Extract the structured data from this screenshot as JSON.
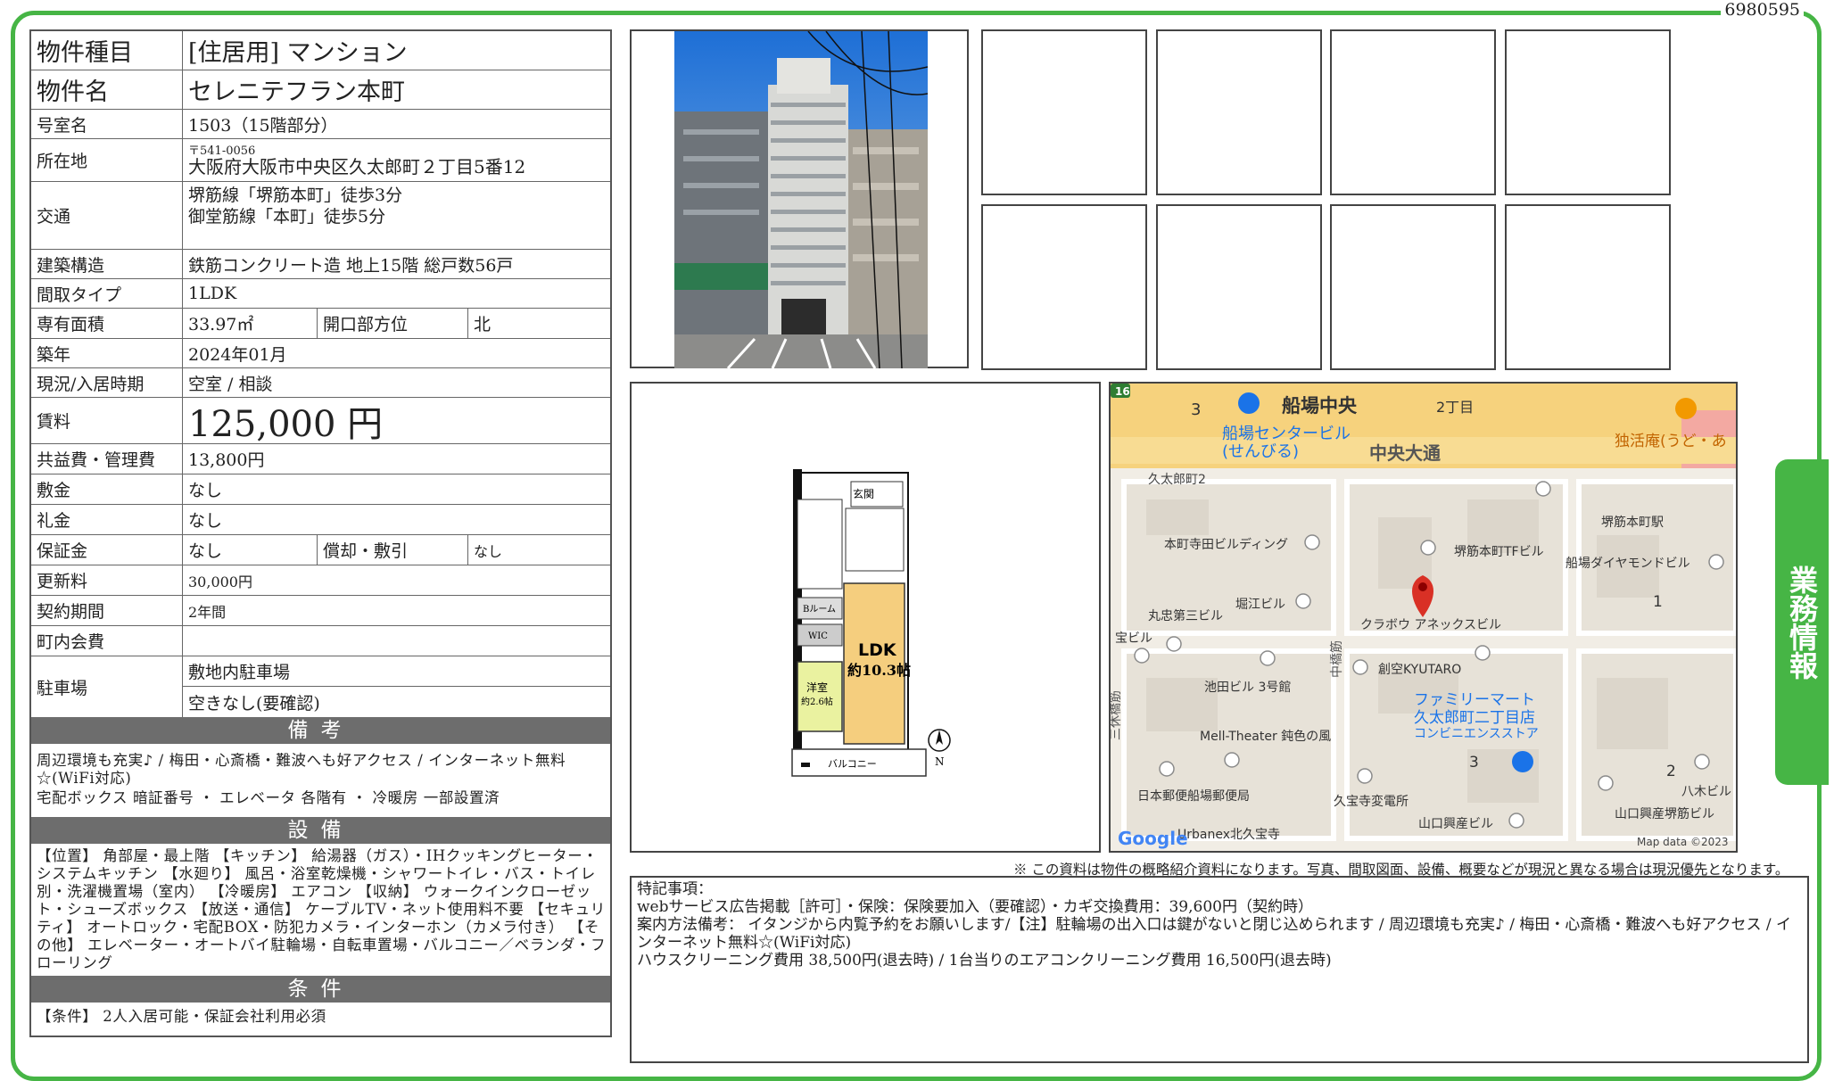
{
  "doc_id": "6980595",
  "side_tab": "業務情報",
  "property": {
    "type_label": "物件種目",
    "type_value": "[住居用] マンション",
    "name_label": "物件名",
    "name_value": "セレニテフラン本町",
    "room_label": "号室名",
    "room_value": "1503（15階部分）",
    "address_label": "所在地",
    "postal": "〒541-0056",
    "address_value": "大阪府大阪市中央区久太郎町２丁目5番12",
    "transport_label": "交通",
    "transport_1": "堺筋線「堺筋本町」徒歩3分",
    "transport_2": "御堂筋線「本町」徒歩5分",
    "structure_label": "建築構造",
    "structure_value": "鉄筋コンクリート造 地上15階 総戸数56戸",
    "layout_label": "間取タイプ",
    "layout_value": "1LDK",
    "area_label": "専有面積",
    "area_value": "33.97㎡",
    "direction_label": "開口部方位",
    "direction_value": "北",
    "built_label": "築年",
    "built_value": "2024年01月",
    "status_label": "現況/入居時期",
    "status_value": "空室 / 相談",
    "rent_label": "賃料",
    "rent_value": "125,000 円",
    "fee_label": "共益費・管理費",
    "fee_value": "13,800円",
    "deposit_label": "敷金",
    "deposit_value": "なし",
    "key_money_label": "礼金",
    "key_money_value": "なし",
    "guarantee_label": "保証金",
    "guarantee_value": "なし",
    "amort_label": "償却・敷引",
    "amort_value": "なし",
    "renewal_label": "更新料",
    "renewal_value": "30,000円",
    "contract_label": "契約期間",
    "contract_value": "2年間",
    "town_label": "町内会費",
    "town_value": "",
    "parking_label": "駐車場",
    "parking_1": "敷地内駐車場",
    "parking_2": "空きなし(要確認)"
  },
  "remarks_section": {
    "title": "備考",
    "line1": "周辺環境も充実♪ / 梅田・心斎橋・難波へも好アクセス / インターネット無料☆(WiFi対応)",
    "line2": "宅配ボックス 暗証番号 ・ エレベータ 各階有 ・ 冷暖房 一部設置済"
  },
  "equipment_section": {
    "title": "設備",
    "text": "【位置】 角部屋・最上階 【キッチン】 給湯器（ガス）・IHクッキングヒーター・システムキッチン 【水廻り】 風呂・浴室乾燥機・シャワートイレ・バス・トイレ別・洗濯機置場（室内） 【冷暖房】 エアコン 【収納】 ウォークインクローゼット・シューズボックス 【放送・通信】 ケーブルTV・ネット使用料不要 【セキュリティ】 オートロック・宅配BOX・防犯カメラ・インターホン（カメラ付き） 【その他】 エレベーター・オートバイ駐輪場・自転車置場・バルコニー／ベランダ・フローリング"
  },
  "conditions_section": {
    "title": "条件",
    "text": "【条件】 2人入居可能・保証会社利用必須"
  },
  "floorplan": {
    "entrance": "玄関",
    "ldk": "LDK",
    "ldk_size": "約10.3帖",
    "western": "洋室",
    "western_size": "約2.6帖",
    "closet": "WIC",
    "shelf": "Bルーム",
    "balcony": "バルコニー",
    "north": "N"
  },
  "map": {
    "labels": [
      "船場中央",
      "2丁目",
      "3",
      "船場センタービル",
      "(せんびる)",
      "中央大通",
      "独活庵(うど・あ",
      "久太郎町2",
      "堺筋本町駅",
      "本町寺田ビルディング",
      "堺筋本町TFビル",
      "船場ダイヤモンドビル",
      "丸忠第三ビル",
      "堀江ビル",
      "クラボウ アネックスビル",
      "宝ビル",
      "創空KYUTARO",
      "池田ビル 3号館",
      "ファミリーマート",
      "久太郎町二丁目店",
      "コンビニエンスストア",
      "Mell-Theater 鈍色の風",
      "久宝寺変電所",
      "日本郵便船場郵便局",
      "山口興産ビル",
      "山口興産堺筋ビル",
      "八木ビル",
      "Urbanex北久宝寺",
      "三休橋筋",
      "中橋筋",
      "1",
      "2",
      "3",
      "16"
    ],
    "google": "Google",
    "credit": "Map data ©2023"
  },
  "disclaimer": "※ この資料は物件の概略紹介資料になります。写真、間取図面、設備、概要などが現況と異なる場合は現況優先となります。",
  "special_notes": {
    "title": "特記事項：",
    "line1": "webサービス広告掲載［許可］・保険：保険要加入（要確認）・カギ交換費用：39,600円（契約時）",
    "line2": "案内方法備考： イタンジから内覧予約をお願いします/【注】駐輪場の出入口は鍵がないと閉じ込められます / 周辺環境も充実♪ / 梅田・心斎橋・難波へも好アクセス / インターネット無料☆(WiFi対応)",
    "line3": "ハウスクリーニング費用 38,500円(退去時) / 1台当りのエアコンクリーニング費用 16,500円(退去時)"
  },
  "colors": {
    "accent_green": "#46b545",
    "section_gray": "#6d6d6d",
    "map_pin_red": "#d93025"
  }
}
